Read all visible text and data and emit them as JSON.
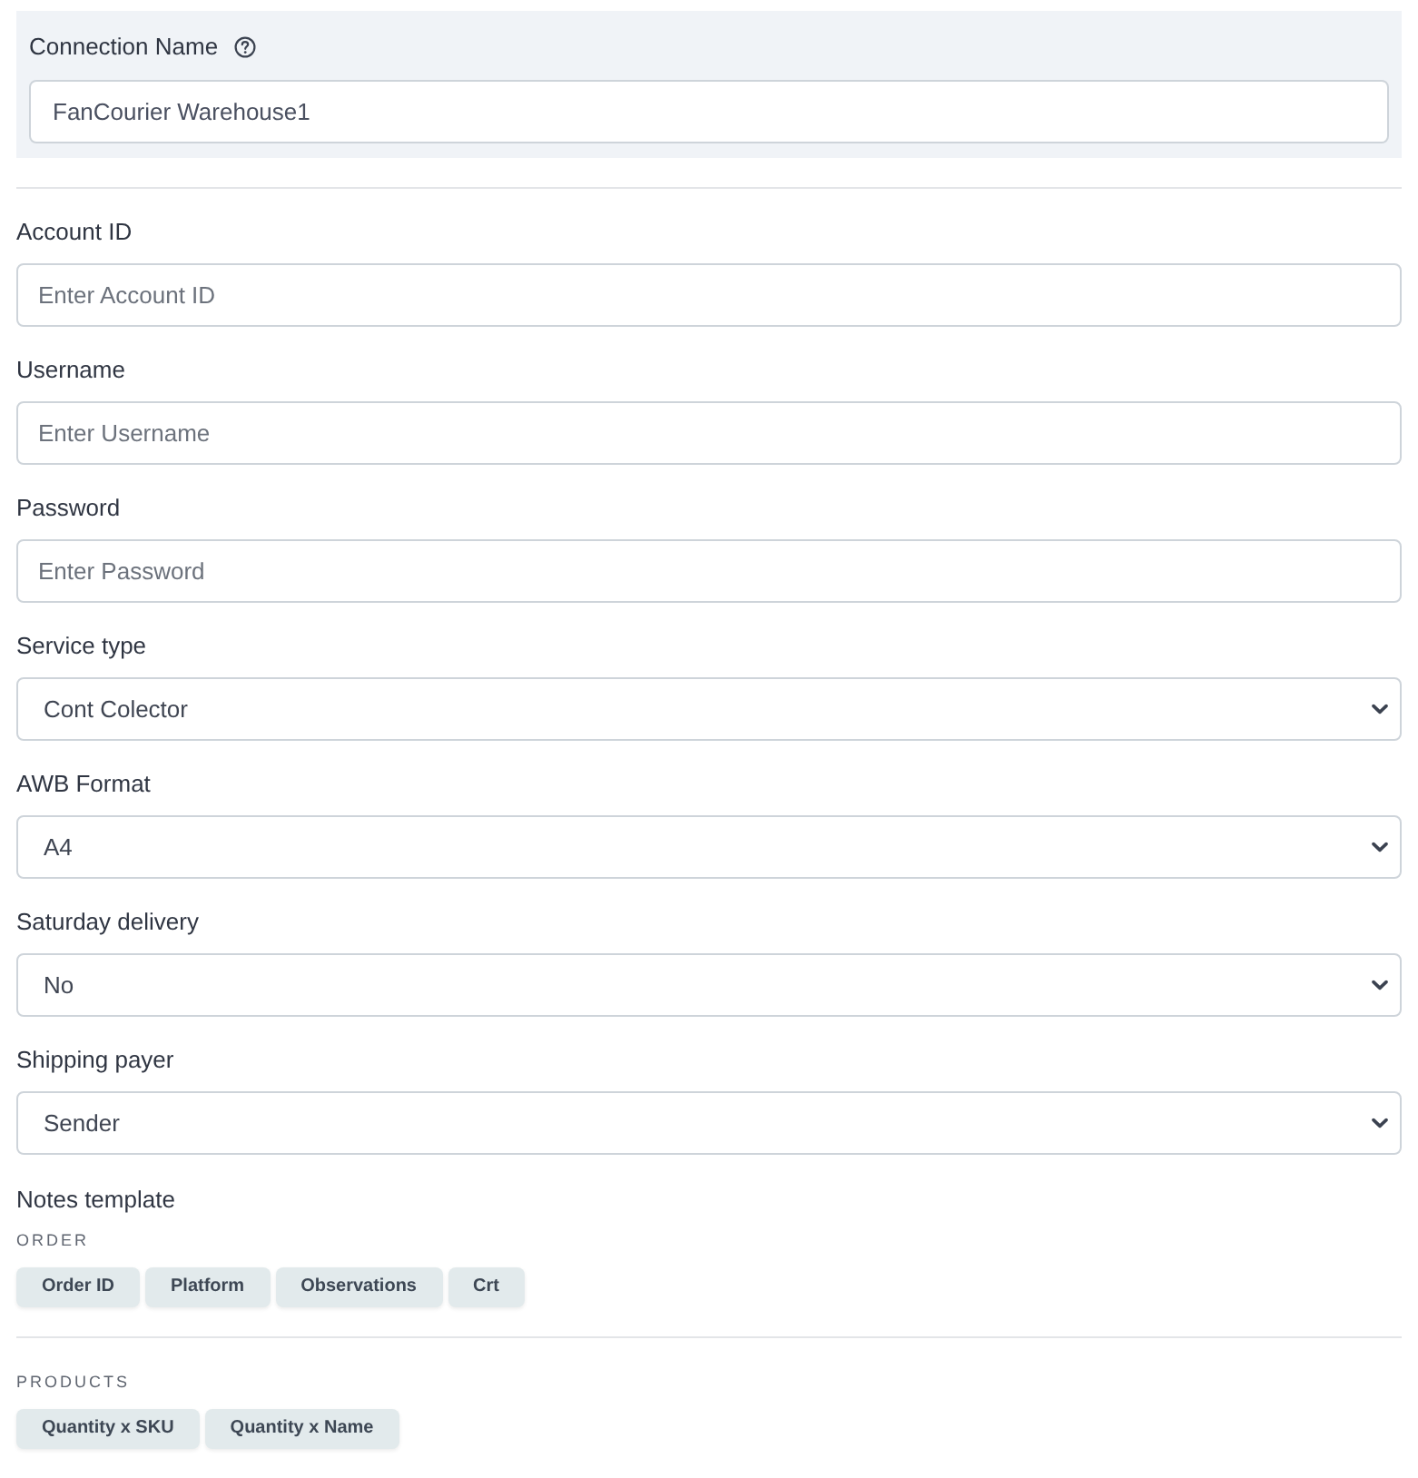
{
  "connection_name": {
    "label": "Connection Name",
    "value": "FanCourier Warehouse1"
  },
  "fields": [
    {
      "kind": "text",
      "label": "Account ID",
      "placeholder": "Enter Account ID"
    },
    {
      "kind": "text",
      "label": "Username",
      "placeholder": "Enter Username"
    },
    {
      "kind": "password",
      "label": "Password",
      "placeholder": "Enter Password"
    },
    {
      "kind": "select",
      "label": "Service type",
      "value": "Cont Colector"
    },
    {
      "kind": "select",
      "label": "AWB Format",
      "value": "A4"
    },
    {
      "kind": "select",
      "label": "Saturday delivery",
      "value": "No"
    },
    {
      "kind": "select",
      "label": "Shipping payer",
      "value": "Sender"
    }
  ],
  "notes_template": {
    "label": "Notes template",
    "groups": [
      {
        "title": "ORDER",
        "chips": [
          "Order ID",
          "Platform",
          "Observations",
          "Crt"
        ]
      },
      {
        "title": "PRODUCTS",
        "chips": [
          "Quantity x SKU",
          "Quantity x Name"
        ]
      }
    ]
  }
}
